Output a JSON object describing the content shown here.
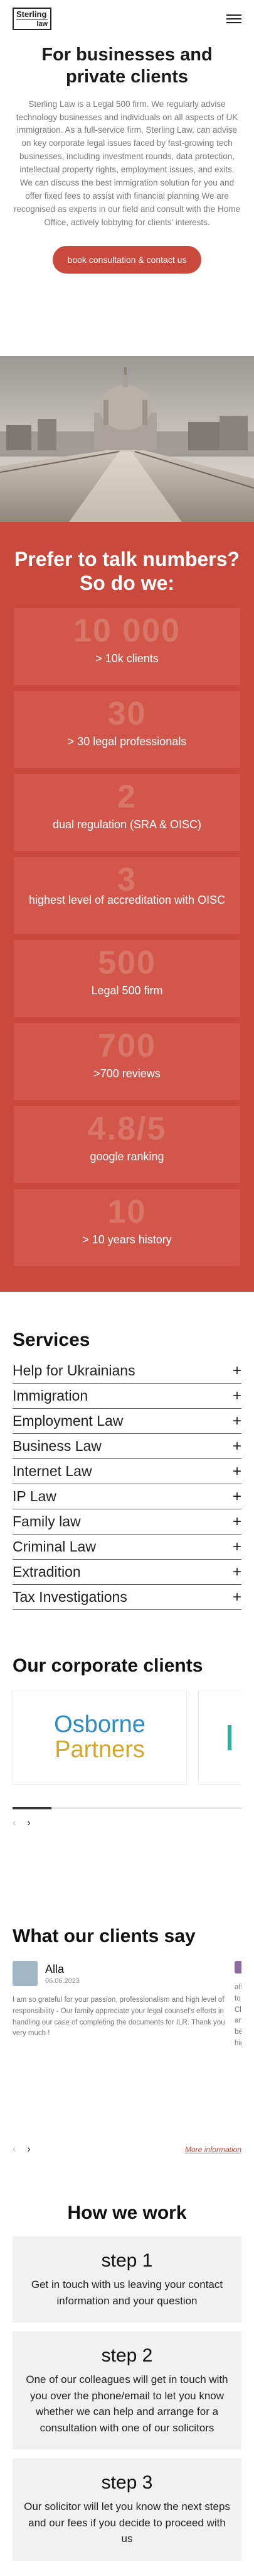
{
  "header": {
    "logo_line1": "Sterling",
    "logo_line2": "law"
  },
  "hero": {
    "title": "For businesses and private clients",
    "body": "Sterling Law is a Legal 500 firm. We regularly advise technology businesses and individuals on all aspects of UK immigration. As a full-service firm, Sterling Law, can advise on key corporate legal issues faced by fast-growing tech businesses, including investment rounds, data protection, intellectual property rights, employment issues, and exits. We can discuss the best immigration solution for you and offer fixed fees to assist with financial planning We are recognised as experts in our field and consult with the Home Office, actively lobbying for clients' interests.",
    "cta_label": "book consultation & contact us"
  },
  "stats": {
    "title": "Prefer to talk numbers? So do we:",
    "items": [
      {
        "big": "10 000",
        "label": "> 10k clients"
      },
      {
        "big": "30",
        "label": "> 30 legal professionals"
      },
      {
        "big": "2",
        "label": "dual regulation (SRA & OISC)"
      },
      {
        "big": "3",
        "label": "highest level of accreditation with OISC"
      },
      {
        "big": "500",
        "label": "Legal 500 firm"
      },
      {
        "big": "700",
        "label": ">700 reviews"
      },
      {
        "big": "4.8/5",
        "label": "google ranking"
      },
      {
        "big": "10",
        "label": "> 10 years history"
      }
    ]
  },
  "services": {
    "title": "Services",
    "items": [
      "Help for Ukrainians",
      "Immigration",
      "Employment Law",
      "Business Law",
      "Internet Law",
      "IP Law",
      "Family law",
      "Criminal Law",
      "Extradition",
      "Tax Investigations"
    ],
    "expand_icon": "+"
  },
  "corporate": {
    "title": "Our corporate clients",
    "client1_line1": "Osborne",
    "client1_line2": "Partners",
    "prev_arrow": "‹",
    "next_arrow": "›",
    "scroll_progress": 0.17
  },
  "testimonials": {
    "title": "What our clients say",
    "review": {
      "name": "Alla",
      "date": "06.06.2023",
      "text": "I am so grateful for your passion, professionalism and high level of responsibility - Our family appreciate your legal counsel's efforts in handling our case of completing the documents for ILR. Thank you very much !"
    },
    "partial_text": "after\nto ret\nClair\nand l\nbefor\nhighly",
    "prev_arrow": "‹",
    "next_arrow": "›",
    "more_label": "More information"
  },
  "how": {
    "title": "How we work",
    "steps": [
      {
        "title": "step 1",
        "text": "Get in touch with us leaving your contact information and your question"
      },
      {
        "title": "step 2",
        "text": "One of our colleagues will get in touch with you over the phone/email to let you know whether we can help and arrange for a consultation with one of our solicitors"
      },
      {
        "title": "step 3",
        "text": "Our solicitor will let you know the next steps and our fees if you decide to proceed with us"
      }
    ]
  },
  "colors": {
    "accent": "#c9493c",
    "stat_card": "#d2574a",
    "osborne_blue": "#2a8dc5",
    "partners_gold": "#d4a72c"
  }
}
